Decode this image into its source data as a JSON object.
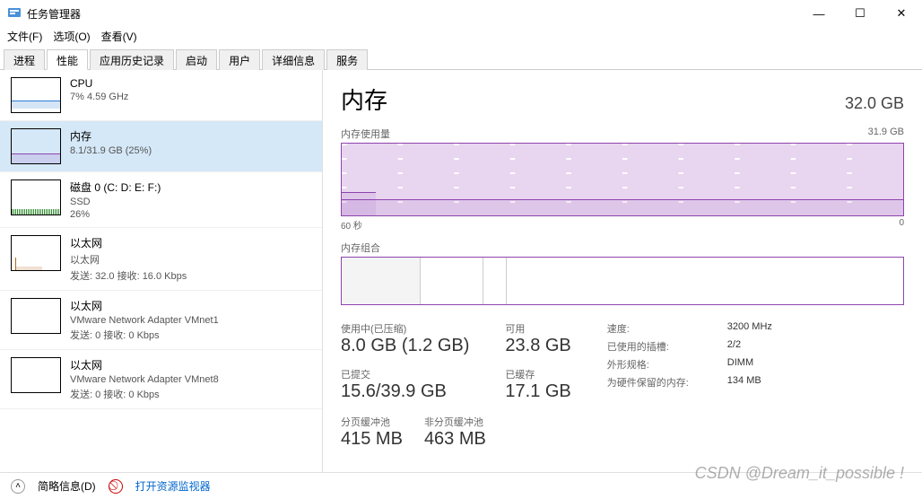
{
  "window": {
    "title": "任务管理器"
  },
  "menu": {
    "file": "文件(F)",
    "options": "选项(O)",
    "view": "查看(V)"
  },
  "tabs": [
    "进程",
    "性能",
    "应用历史记录",
    "启动",
    "用户",
    "详细信息",
    "服务"
  ],
  "sidebar": {
    "items": [
      {
        "name": "CPU",
        "sub1": "7% 4.59 GHz",
        "sub2": ""
      },
      {
        "name": "内存",
        "sub1": "8.1/31.9 GB (25%)",
        "sub2": ""
      },
      {
        "name": "磁盘 0 (C: D: E: F:)",
        "sub1": "SSD",
        "sub2": "26%"
      },
      {
        "name": "以太网",
        "sub1": "以太网",
        "sub2": "发送: 32.0 接收: 16.0 Kbps"
      },
      {
        "name": "以太网",
        "sub1": "VMware Network Adapter VMnet1",
        "sub2": "发送: 0 接收: 0 Kbps"
      },
      {
        "name": "以太网",
        "sub1": "VMware Network Adapter VMnet8",
        "sub2": "发送: 0 接收: 0 Kbps"
      }
    ]
  },
  "main": {
    "title": "内存",
    "total": "32.0 GB",
    "usage_label": "内存使用量",
    "usage_max": "31.9 GB",
    "axis_left": "60 秒",
    "axis_right": "0",
    "comp_label": "内存组合",
    "comp_segments": [
      14,
      11,
      4,
      71
    ],
    "stats": {
      "in_use_label": "使用中(已压缩)",
      "in_use_value": "8.0 GB (1.2 GB)",
      "avail_label": "可用",
      "avail_value": "23.8 GB",
      "commit_label": "已提交",
      "commit_value": "15.6/39.9 GB",
      "cached_label": "已缓存",
      "cached_value": "17.1 GB",
      "paged_label": "分页缓冲池",
      "paged_value": "415 MB",
      "nonpaged_label": "非分页缓冲池",
      "nonpaged_value": "463 MB"
    },
    "meta": {
      "speed_k": "速度:",
      "speed_v": "3200 MHz",
      "slots_k": "已使用的插槽:",
      "slots_v": "2/2",
      "form_k": "外形规格:",
      "form_v": "DIMM",
      "reserved_k": "为硬件保留的内存:",
      "reserved_v": "134 MB"
    }
  },
  "footer": {
    "brief": "简略信息(D)",
    "resmon": "打开资源监视器"
  },
  "watermark": "CSDN @Dream_it_possible !",
  "chart_data": {
    "type": "line",
    "title": "内存使用量",
    "xlabel": "60 秒",
    "ylabel": "",
    "ylim": [
      0,
      31.9
    ],
    "x_seconds": [
      60,
      54,
      48,
      42,
      36,
      30,
      24,
      18,
      12,
      6,
      0
    ],
    "series": [
      {
        "name": "内存使用量 (GB)",
        "values": [
          10.2,
          10.0,
          8.1,
          8.0,
          8.0,
          8.0,
          8.0,
          8.0,
          8.0,
          8.0,
          8.0
        ]
      }
    ]
  }
}
